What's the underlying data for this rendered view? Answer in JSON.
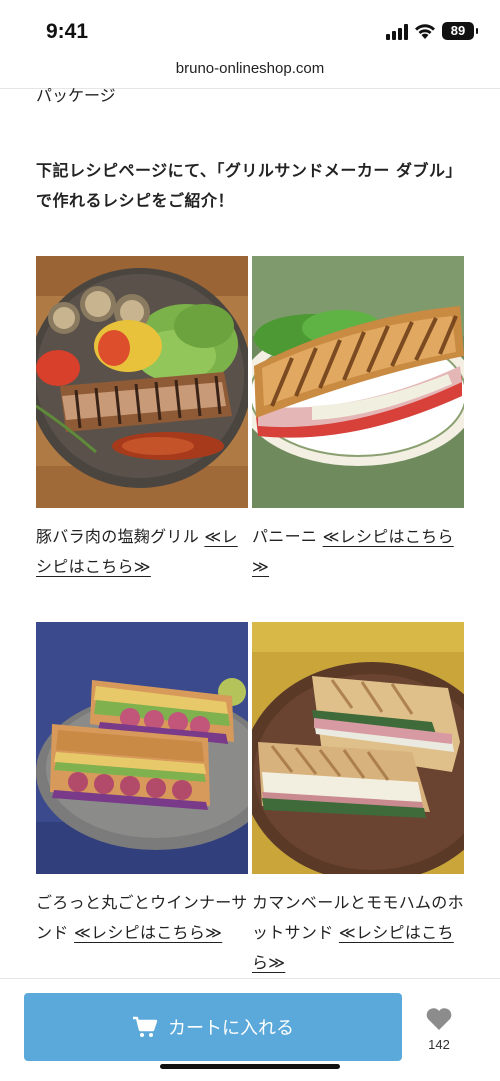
{
  "status": {
    "time": "9:41",
    "battery": "89"
  },
  "browser": {
    "url": "bruno-onlineshop.com"
  },
  "content": {
    "package_text": "パッケージ",
    "intro": "下記レシピページにて、「グリルサンドメーカー ダブル」で作れるレシピをご紹介！",
    "recipes": [
      {
        "title": "豚バラ肉の塩麹グリル ",
        "link": "≪レシピはこちら≫"
      },
      {
        "title": "パニーニ ",
        "link": "≪レシピはこちら≫"
      },
      {
        "title": "ごろっと丸ごとウインナーサンド ",
        "link": "≪レシピはこちら≫"
      },
      {
        "title": "カマンベールとモモハムのホットサンド ",
        "link": "≪レシピはこちら≫"
      }
    ]
  },
  "bottom": {
    "cart_label": "カートに入れる",
    "favorite_count": "142"
  },
  "colors": {
    "cart_button": "#5aa9da"
  }
}
